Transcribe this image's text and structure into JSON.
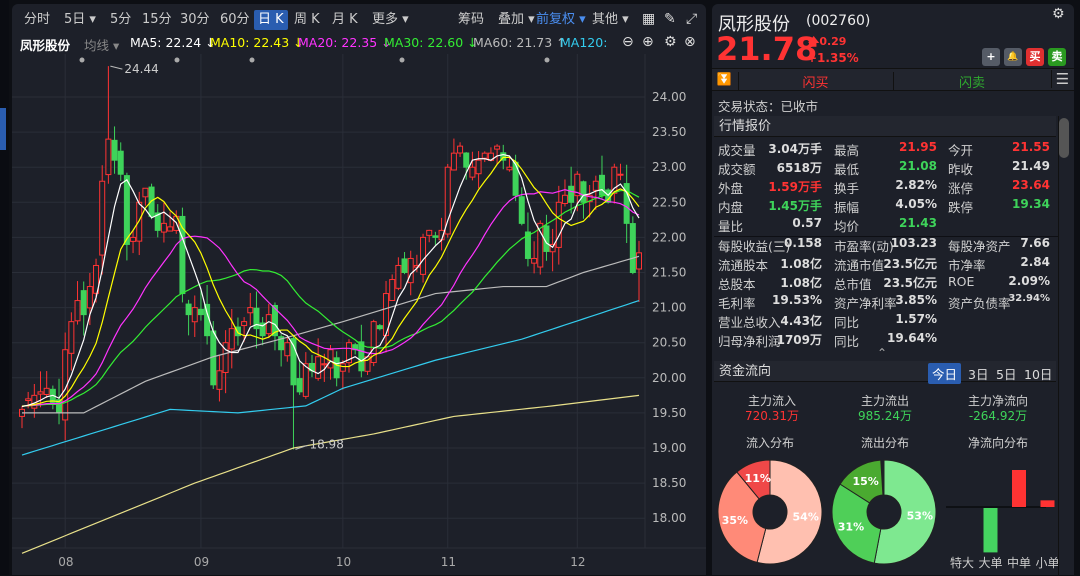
{
  "toolbar": {
    "tabs": [
      "分时",
      "5日 ▾",
      "5分",
      "15分",
      "30分",
      "60分",
      "日 K",
      "周 K",
      "月 K",
      "更多 ▾"
    ],
    "active": "日 K",
    "right": {
      "chips": "筹码",
      "overlay": "叠加 ▾",
      "adjust": "前复权 ▾",
      "other": "其他 ▾"
    }
  },
  "ma_row": {
    "name": "凤形股份",
    "avg": "均线 ▾",
    "ma5": "MA5: 22.24 ↓",
    "ma10": "MA10: 22.43 ↓",
    "ma20": "MA20: 22.35 ↓",
    "ma30": "MA30: 22.60 ↓",
    "ma60": "MA60: 21.73 ↑",
    "ma120": "MA120:"
  },
  "colors": {
    "up": "#ff3333",
    "down": "#3ed35a",
    "ma5": "#ffffff",
    "ma10": "#ffff00",
    "ma20": "#ff33ff",
    "ma30": "#33ee33",
    "ma60": "#bbbbbb",
    "ma120": "#33ccee",
    "ma250": "#e8e08a"
  },
  "chart_data": {
    "type": "candlestick",
    "y_ticks": [
      "24.00",
      "23.50",
      "23.00",
      "22.50",
      "22.00",
      "21.50",
      "21.00",
      "20.50",
      "20.00",
      "19.50",
      "19.00",
      "18.50",
      "18.00"
    ],
    "ylim": [
      17.45,
      24.5
    ],
    "x_ticks": [
      {
        "label": "08",
        "index": 7
      },
      {
        "label": "09",
        "index": 29
      },
      {
        "label": "10",
        "index": 52
      },
      {
        "label": "11",
        "index": 69
      },
      {
        "label": "12",
        "index": 90
      }
    ],
    "annotations": [
      {
        "text": "24.44",
        "index": 14,
        "price": 24.44
      },
      {
        "text": "18.98",
        "index": 44,
        "price": 18.98
      }
    ],
    "closes": [
      19.55,
      19.7,
      19.75,
      19.8,
      19.85,
      19.65,
      19.5,
      20.4,
      20.8,
      21.1,
      20.9,
      21.3,
      21.6,
      22.8,
      23.4,
      23.1,
      22.9,
      21.9,
      22.0,
      22.5,
      22.7,
      22.3,
      22.1,
      22.2,
      22.15,
      22.3,
      21.2,
      20.9,
      21.0,
      20.9,
      20.6,
      19.9,
      20.1,
      20.5,
      20.7,
      20.6,
      20.8,
      21.0,
      20.7,
      20.6,
      20.9,
      20.6,
      20.4,
      20.5,
      19.9,
      19.8,
      20.2,
      20.1,
      20.3,
      20.2,
      20.4,
      20.0,
      20.2,
      20.5,
      20.4,
      20.1,
      20.3,
      20.8,
      20.7,
      21.2,
      21.4,
      21.6,
      21.5,
      21.7,
      21.6,
      22.0,
      22.1,
      22.0,
      22.1,
      23.0,
      23.2,
      23.3,
      23.0,
      23.0,
      23.1,
      23.2,
      23.2,
      23.3,
      23.1,
      23.0,
      22.6,
      22.2,
      21.7,
      21.7,
      22.2,
      21.8,
      21.9,
      22.5,
      22.6,
      22.5,
      22.9,
      22.5,
      22.6,
      22.8,
      22.6,
      22.5,
      23.0,
      22.9,
      22.2,
      21.5,
      21.78
    ],
    "last_candle": {
      "open": 21.55,
      "high": 21.95,
      "low": 21.08,
      "close": 21.78
    },
    "ma60_anchors": [
      [
        0,
        19.5
      ],
      [
        10,
        19.5
      ],
      [
        20,
        19.95
      ],
      [
        31,
        20.3
      ],
      [
        44,
        20.6
      ],
      [
        52,
        20.8
      ],
      [
        67,
        21.2
      ],
      [
        78,
        21.3
      ],
      [
        85,
        21.3
      ],
      [
        91,
        21.5
      ],
      [
        100,
        21.73
      ]
    ],
    "ma120_anchors": [
      [
        0,
        18.9
      ],
      [
        24,
        19.55
      ],
      [
        35,
        19.5
      ],
      [
        46,
        19.6
      ],
      [
        52,
        19.85
      ],
      [
        67,
        20.25
      ],
      [
        81,
        20.55
      ],
      [
        100,
        21.1
      ]
    ],
    "ma250_anchors": [
      [
        0,
        17.5
      ],
      [
        28,
        18.5
      ],
      [
        44,
        19.0
      ],
      [
        57,
        19.2
      ],
      [
        70,
        19.45
      ],
      [
        86,
        19.6
      ],
      [
        100,
        19.75
      ]
    ]
  },
  "quote": {
    "name": "凤形股份",
    "code": "(002760)",
    "price": "21.78",
    "change": "0.29",
    "pct": "+1.35%",
    "buttons": {
      "add": "+",
      "alert": "🔔",
      "buy": "买",
      "sell": "卖"
    },
    "flash_buy": "闪买",
    "flash_sell": "闪卖",
    "status": "交易状态：已收市",
    "section": "行情报价"
  },
  "stats": [
    [
      [
        "成交量",
        "3.04万手",
        ""
      ],
      [
        "最高",
        "21.95",
        "red"
      ],
      [
        "今开",
        "21.55",
        "red"
      ]
    ],
    [
      [
        "成交额",
        "6518万",
        ""
      ],
      [
        "最低",
        "21.08",
        "green"
      ],
      [
        "昨收",
        "21.49",
        ""
      ]
    ],
    [
      [
        "外盘",
        "1.59万手",
        "red"
      ],
      [
        "换手",
        "2.82%",
        ""
      ],
      [
        "涨停",
        "23.64",
        "red"
      ]
    ],
    [
      [
        "内盘",
        "1.45万手",
        "green"
      ],
      [
        "振幅",
        "4.05%",
        ""
      ],
      [
        "跌停",
        "19.34",
        "green"
      ]
    ],
    [
      [
        "量比",
        "0.57",
        ""
      ],
      [
        "均价",
        "21.43",
        "green"
      ],
      [
        "",
        "",
        " "
      ]
    ]
  ],
  "fund": [
    [
      [
        "每股收益(三)",
        "0.158"
      ],
      [
        "市盈率(动)",
        "103.23"
      ],
      [
        "每股净资产",
        "7.66"
      ]
    ],
    [
      [
        "流通股本",
        "1.08亿"
      ],
      [
        "流通市值",
        "23.5亿元"
      ],
      [
        "市净率",
        "2.84"
      ]
    ],
    [
      [
        "总股本",
        "1.08亿"
      ],
      [
        "总市值",
        "23.5亿元"
      ],
      [
        "ROE",
        "2.09%"
      ]
    ],
    [
      [
        "毛利率",
        "19.53%"
      ],
      [
        "资产净利率",
        "3.85%"
      ],
      [
        "资产负债率",
        "32.94%"
      ]
    ],
    [
      [
        "营业总收入",
        "4.43亿"
      ],
      [
        "同比",
        "1.57%"
      ],
      [
        "",
        ""
      ]
    ],
    [
      [
        "归母净利润",
        "1709万"
      ],
      [
        "同比",
        "19.64%"
      ],
      [
        "",
        ""
      ]
    ]
  ],
  "flow": {
    "title": "资金流向",
    "periods": [
      "今日",
      "3日",
      "5日",
      "10日"
    ],
    "active": "今日",
    "inflow_label": "主力流入",
    "inflow": "720.31万",
    "outflow_label": "主力流出",
    "outflow": "985.24万",
    "net_label": "主力净流向",
    "net": "-264.92万",
    "in_title": "流入分布",
    "out_title": "流出分布",
    "net_title": "净流向分布",
    "in_dist": [
      {
        "pct": 54,
        "label": "54%",
        "color": "#ffc0b0"
      },
      {
        "pct": 35,
        "label": "35%",
        "color": "#ff8a78"
      },
      {
        "pct": 11,
        "label": "11%",
        "color": "#f04848"
      }
    ],
    "out_dist": [
      {
        "pct": 53,
        "label": "53%",
        "color": "#7ee890"
      },
      {
        "pct": 31,
        "label": "31%",
        "color": "#4fcf58"
      },
      {
        "pct": 15,
        "label": "15%",
        "color": "#4aaa30"
      }
    ],
    "net_bars": [
      {
        "label": "特大",
        "value": 0
      },
      {
        "label": "大单",
        "value": -120
      },
      {
        "label": "中单",
        "value": 100
      },
      {
        "label": "小单",
        "value": 18
      }
    ]
  }
}
